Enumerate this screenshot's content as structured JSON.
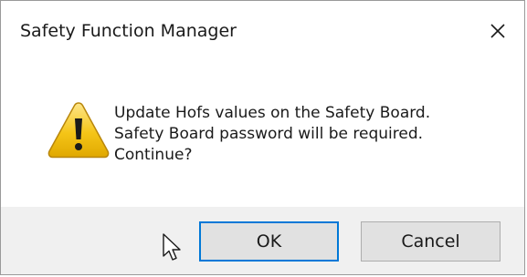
{
  "window": {
    "title": "Safety Function Manager",
    "close_icon": "close-icon"
  },
  "message": {
    "icon": "warning-icon",
    "lines": [
      "Update Hofs values on the Safety Board.",
      "Safety Board password will be required.",
      "Continue?"
    ]
  },
  "buttons": {
    "ok_label": "OK",
    "cancel_label": "Cancel"
  },
  "colors": {
    "focus_border": "#0078d7",
    "footer_bg": "#f0f0f0",
    "button_bg": "#e1e1e1",
    "warning_yellow": "#f5c518"
  }
}
